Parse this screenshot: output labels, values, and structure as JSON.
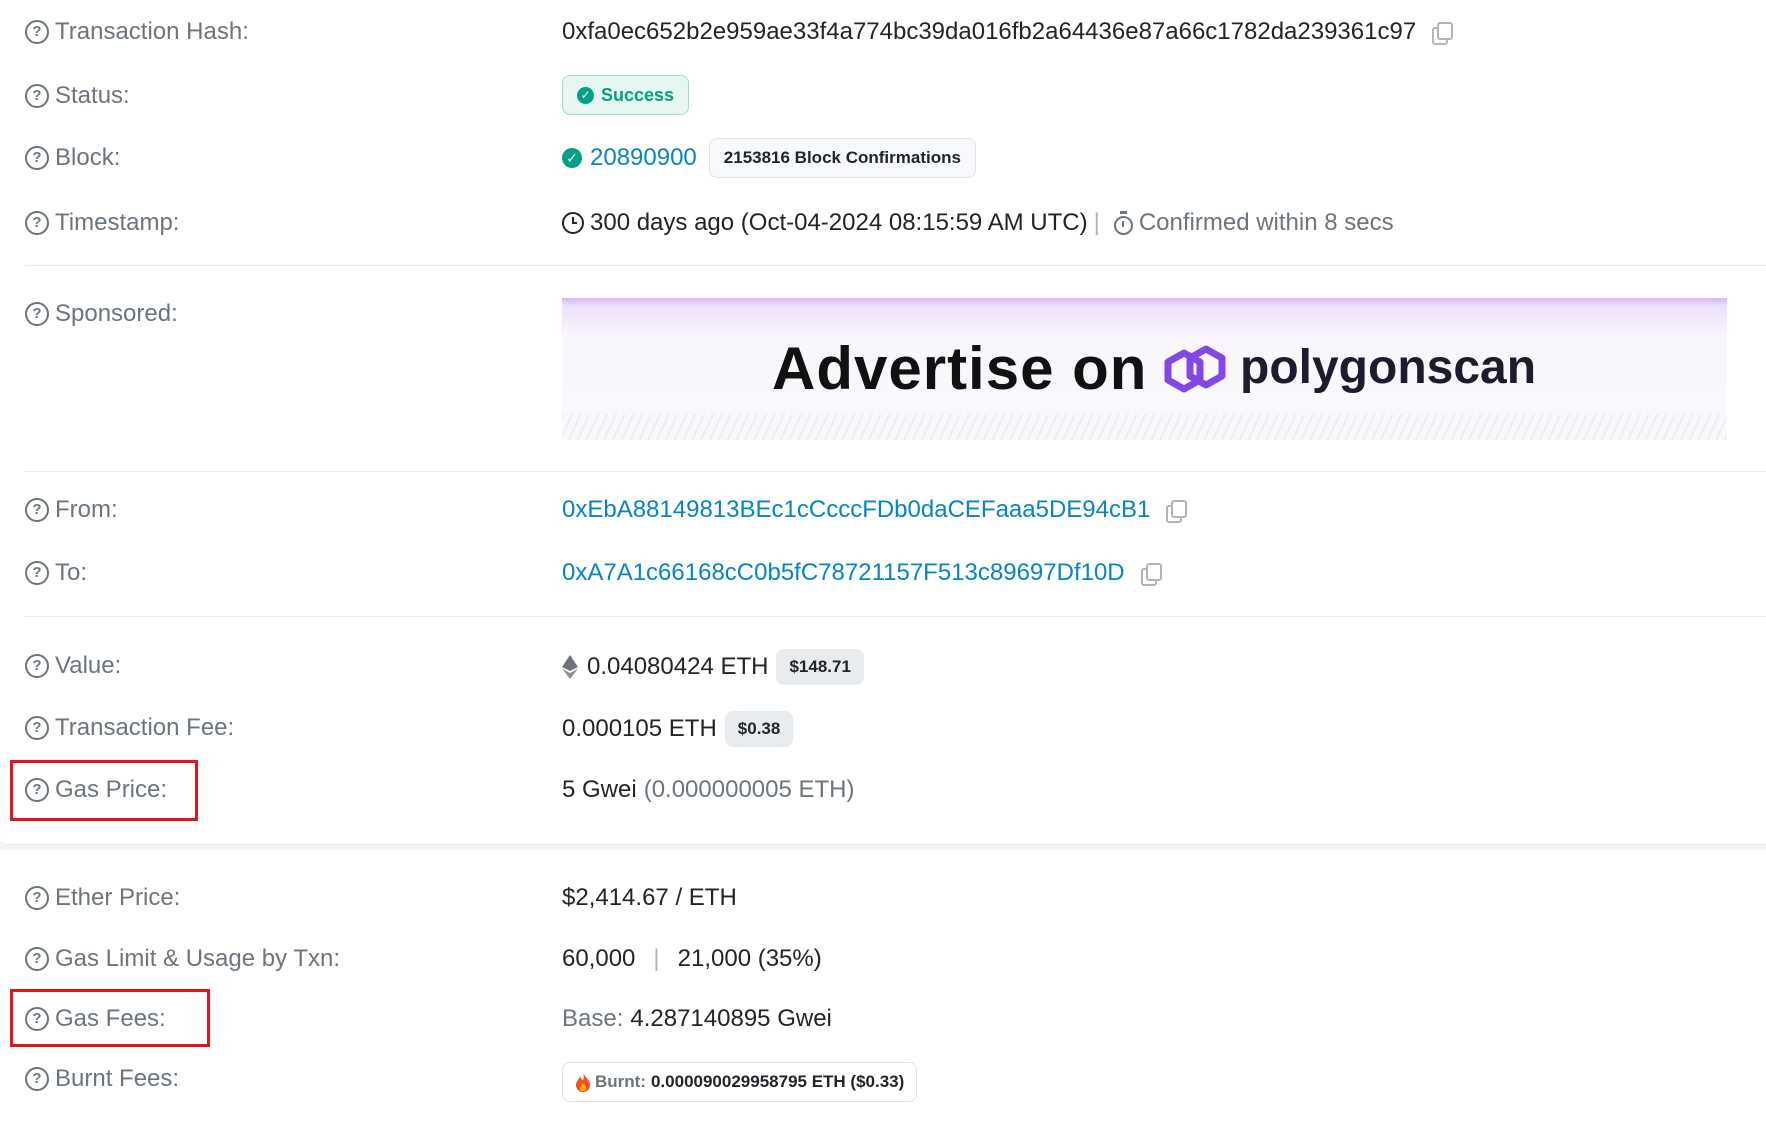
{
  "tx_hash": {
    "label": "Transaction Hash:",
    "value": "0xfa0ec652b2e959ae33f4a774bc39da016fb2a64436e87a66c1782da239361c97"
  },
  "status": {
    "label": "Status:",
    "value": "Success"
  },
  "block": {
    "label": "Block:",
    "number": "20890900",
    "confirmations": "2153816 Block Confirmations"
  },
  "timestamp": {
    "label": "Timestamp:",
    "value": "300 days ago (Oct-04-2024 08:15:59 AM UTC)",
    "separator": "|",
    "confirmed": "Confirmed within 8 secs"
  },
  "sponsored": {
    "label": "Sponsored:",
    "ad_text": "Advertise on",
    "ad_brand": "polygonscan"
  },
  "from": {
    "label": "From:",
    "address": "0xEbA88149813BEc1cCcccFDb0daCEFaaa5DE94cB1"
  },
  "to": {
    "label": "To:",
    "address": "0xA7A1c66168cC0b5fC78721157F513c89697Df10D"
  },
  "value": {
    "label": "Value:",
    "amount": "0.04080424 ETH",
    "usd": "$148.71"
  },
  "tx_fee": {
    "label": "Transaction Fee:",
    "amount": "0.000105 ETH",
    "usd": "$0.38"
  },
  "gas_price": {
    "label": "Gas Price:",
    "gwei": "5 Gwei",
    "eth": "(0.000000005 ETH)"
  },
  "ether_price": {
    "label": "Ether Price:",
    "value": "$2,414.67 / ETH"
  },
  "gas_limit": {
    "label": "Gas Limit & Usage by Txn:",
    "limit": "60,000",
    "separator": "|",
    "usage": "21,000 (35%)"
  },
  "gas_fees": {
    "label": "Gas Fees:",
    "base_label": "Base:",
    "base_value": "4.287140895 Gwei"
  },
  "burnt_fees": {
    "label": "Burnt Fees:",
    "burnt_label": "Burnt:",
    "burnt_value": "0.000090029958795 ETH ($0.33)"
  },
  "colors": {
    "link": "#0784c3",
    "success": "#00a186",
    "highlight": "#e0161b"
  },
  "icons": [
    "question-icon",
    "copy-icon",
    "check-circle-icon",
    "clock-icon",
    "timer-icon",
    "ethereum-icon",
    "fire-icon",
    "polygon-logo"
  ]
}
